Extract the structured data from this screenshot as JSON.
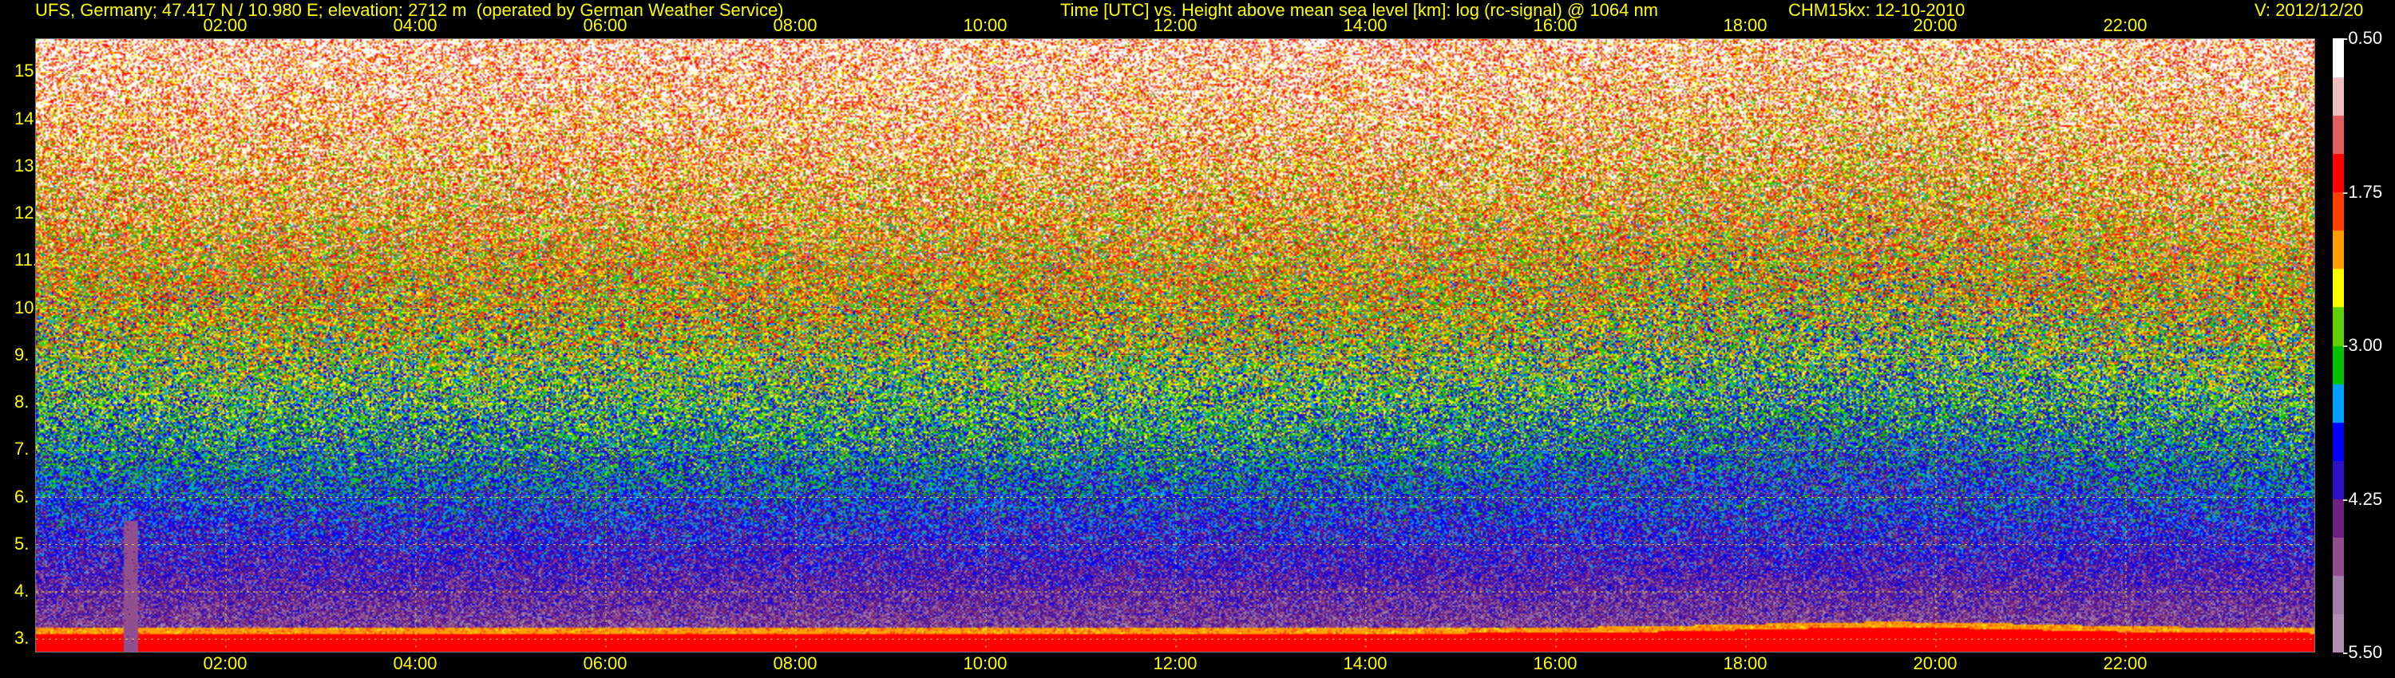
{
  "header": {
    "station": "UFS, Germany; 47.417 N / 10.980 E; elevation: 2712 m  (operated by German Weather Service)",
    "description": "Time [UTC] vs. Height above mean sea level [km]: log (rc-signal) @ 1064 nm",
    "instrument": "CHM15kx: 12-10-2010",
    "version": "V: 2012/12/20"
  },
  "chart_data": {
    "type": "heatmap",
    "title": "Time [UTC] vs. Height above mean sea level [km]: log (rc-signal) @ 1064 nm",
    "xlabel": "",
    "ylabel": "",
    "x_unit": "hours UTC",
    "xlim": [
      0,
      24
    ],
    "ylim": [
      2.7,
      15.7
    ],
    "x_ticks": [
      "02:00",
      "04:00",
      "06:00",
      "08:00",
      "10:00",
      "12:00",
      "14:00",
      "16:00",
      "18:00",
      "20:00",
      "22:00"
    ],
    "x_tick_values": [
      2,
      4,
      6,
      8,
      10,
      12,
      14,
      16,
      18,
      20,
      22
    ],
    "y_ticks": [
      "3.",
      "4.",
      "5.",
      "6.",
      "7.",
      "8.",
      "9.",
      "10.",
      "11.",
      "12.",
      "13.",
      "14.",
      "15."
    ],
    "y_tick_values": [
      3,
      4,
      5,
      6,
      7,
      8,
      9,
      10,
      11,
      12,
      13,
      14,
      15
    ],
    "grid": true,
    "colorbar": {
      "min": -5.5,
      "max": -0.5,
      "tick_labels": [
        "-0.50",
        "-1.75",
        "-3.00",
        "-4.25",
        "-5.50"
      ],
      "tick_values": [
        -0.5,
        -1.75,
        -3.0,
        -4.25,
        -5.5
      ],
      "colors": [
        "#b090b0",
        "#a080a8",
        "#905090",
        "#702080",
        "#3010c0",
        "#0000ff",
        "#00a0ff",
        "#00c000",
        "#60d000",
        "#ffff00",
        "#ffa000",
        "#ff4000",
        "#ff0000",
        "#e06060",
        "#f0c0c0",
        "#ffffff"
      ]
    },
    "features": {
      "surface_layer_height_km": 3.0,
      "plume_time_h": 1.0
    }
  }
}
